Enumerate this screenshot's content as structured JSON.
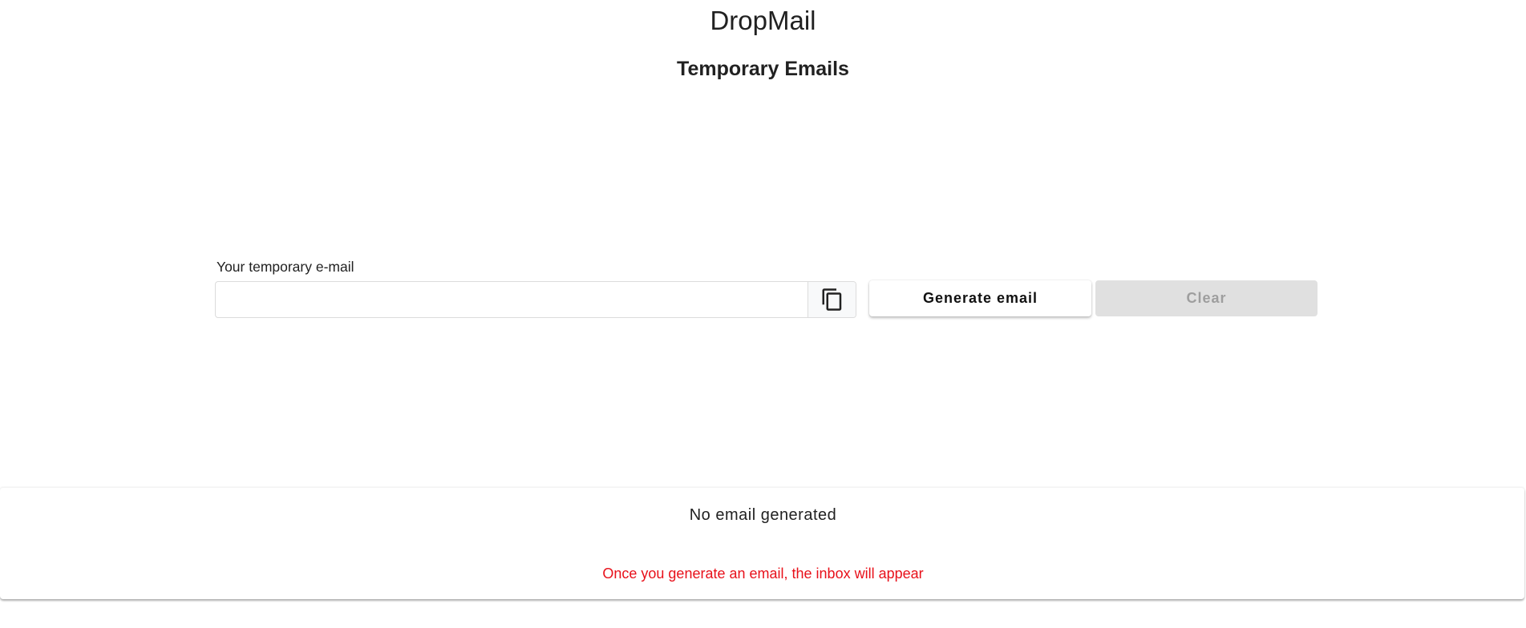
{
  "app": {
    "title": "DropMail"
  },
  "header": {
    "page_title": "Temporary Emails"
  },
  "email_form": {
    "label": "Your temporary e-mail",
    "value": "",
    "placeholder": "",
    "copy_icon": "copy-icon",
    "generate_label": "Generate email",
    "clear_label": "Clear"
  },
  "inbox": {
    "status": "No email generated",
    "hint": "Once you generate an email, the inbox will appear"
  },
  "colors": {
    "hint_text": "#e8101a",
    "disabled_button_bg": "#e0e0e0",
    "disabled_button_text": "#9e9e9e"
  }
}
